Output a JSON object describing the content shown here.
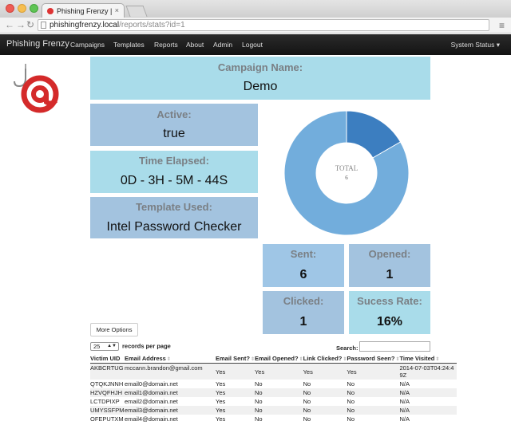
{
  "browser": {
    "tab_title": "Phishing Frenzy |",
    "tab_close": "×",
    "url_host": "phishingfrenzy.local",
    "url_path": "/reports/stats?id=1",
    "back_icon": "arrow-left",
    "forward_icon": "arrow-right",
    "reload_icon": "reload",
    "menu_icon": "hamburger"
  },
  "navbar": {
    "brand": "Phishing Frenzy",
    "links": [
      "Campaigns",
      "Templates",
      "Reports",
      "About",
      "Admin",
      "Logout"
    ],
    "system_status": "System Status ▾"
  },
  "campaign": {
    "name_label": "Campaign Name:",
    "name": "Demo",
    "active_label": "Active:",
    "active": "true",
    "elapsed_label": "Time Elapsed:",
    "elapsed": "0D - 3H - 5M - 44S",
    "template_label": "Template Used:",
    "template": "Intel Password Checker"
  },
  "stats": {
    "sent_label": "Sent:",
    "sent": "6",
    "opened_label": "Opened:",
    "opened": "1",
    "clicked_label": "Clicked:",
    "clicked": "1",
    "rate_label": "Sucess Rate:",
    "rate": "16%"
  },
  "chart_data": {
    "type": "pie",
    "center_label": "TOTAL",
    "center_value": "6",
    "slices": [
      {
        "label": "",
        "value": 1,
        "color": "#3c7ec0"
      },
      {
        "label": "",
        "value": 5,
        "color": "#72addc"
      }
    ]
  },
  "controls": {
    "more_options": "More Options",
    "page_size": "25",
    "records_label": "records per page",
    "search_label": "Search:"
  },
  "table": {
    "headers": [
      "Victim UID",
      "Email Address",
      "Email Sent?",
      "Email Opened?",
      "Link Clicked?",
      "Password Seen?",
      "Time Visited"
    ],
    "rows": [
      [
        "AKBCRTUG",
        "mccann.brandon@gmail.com",
        "Yes",
        "Yes",
        "Yes",
        "Yes",
        "2014-07-03T04:24:49Z"
      ],
      [
        "QTQKJNNH",
        "email0@domain.net",
        "Yes",
        "No",
        "No",
        "No",
        "N/A"
      ],
      [
        "HZVQFHJH",
        "email1@domain.net",
        "Yes",
        "No",
        "No",
        "No",
        "N/A"
      ],
      [
        "LCTDPIXP",
        "email2@domain.net",
        "Yes",
        "No",
        "No",
        "No",
        "N/A"
      ],
      [
        "UMYSSFPM",
        "email3@domain.net",
        "Yes",
        "No",
        "No",
        "No",
        "N/A"
      ],
      [
        "OFEPUTXM",
        "email4@domain.net",
        "Yes",
        "No",
        "No",
        "No",
        "N/A"
      ]
    ]
  }
}
